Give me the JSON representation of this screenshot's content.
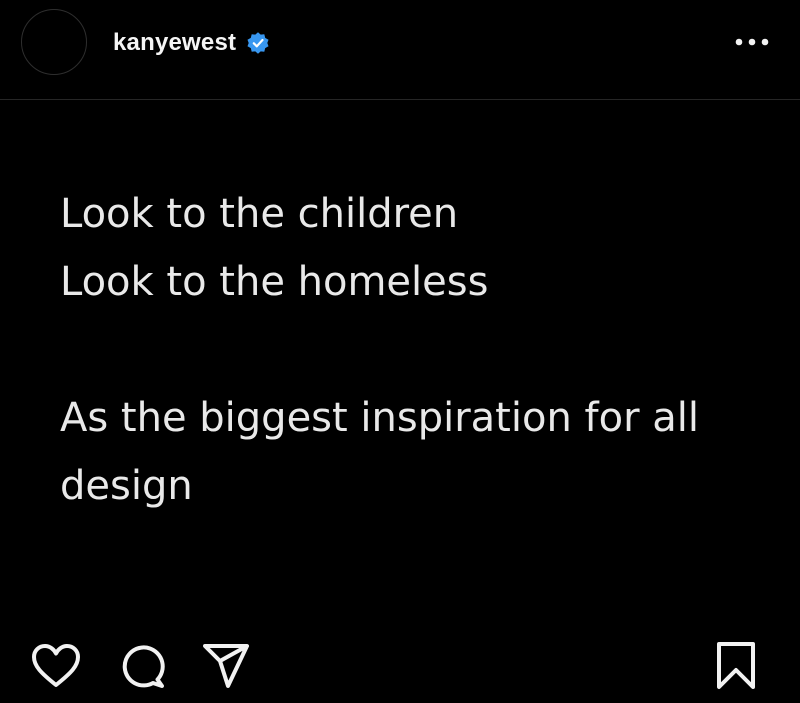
{
  "header": {
    "username": "kanyewest",
    "verified": true,
    "verified_color": "#3897f0",
    "avatar_icon": "avatar",
    "more_icon": "more-options-icon"
  },
  "post": {
    "lines": [
      "Look to the children",
      "Look to the homeless",
      "",
      "As the biggest inspiration for all",
      "design"
    ]
  },
  "actions": {
    "like_icon": "heart-icon",
    "comment_icon": "comment-icon",
    "share_icon": "share-icon",
    "save_icon": "bookmark-icon"
  },
  "theme": {
    "background": "#000000",
    "text": "#e9e9e9"
  }
}
